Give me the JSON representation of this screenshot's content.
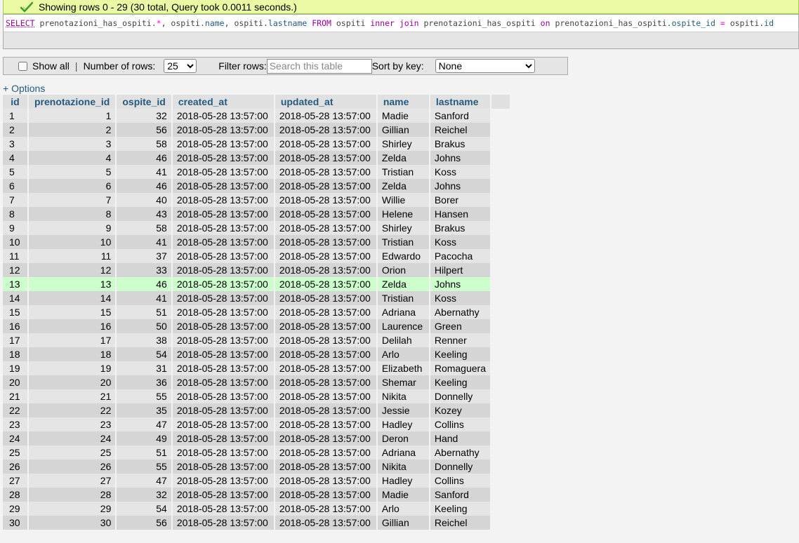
{
  "status": {
    "message": "Showing rows 0 - 29 (30 total, Query took 0.0011 seconds.)",
    "icon": "check-icon",
    "color": "#3c9d2e"
  },
  "sql": {
    "select_kw": "SELECT",
    "part1": " prenotazioni_has_ospiti.",
    "star": "*",
    "part2": ", ospiti.",
    "col_name": "name",
    "part3": ", ospiti.",
    "col_lastname": "lastname",
    "from_kw": " FROM ",
    "table1": "ospiti ",
    "join_kw": "inner join",
    "table2": " prenotazioni_has_ospiti ",
    "on_kw": "on",
    "part4": " prenotazioni_has_ospiti.",
    "col_ospite_id": "ospite_id",
    "eq": " = ",
    "part5": "ospiti.",
    "col_id": "id"
  },
  "navbar": {
    "show_all_label": "Show all",
    "separator": "|",
    "rows_label": "Number of rows:",
    "rows_value": "25",
    "filter_label": "Filter rows:",
    "filter_placeholder": "Search this table",
    "sort_label": "Sort by key:",
    "sort_value": "None"
  },
  "options_link": "+ Options",
  "table": {
    "columns": [
      "id",
      "prenotazione_id",
      "ospite_id",
      "created_at",
      "updated_at",
      "name",
      "lastname"
    ],
    "highlight_row": 13,
    "rows": [
      [
        "1",
        "1",
        "32",
        "2018-05-28 13:57:00",
        "2018-05-28 13:57:00",
        "Madie",
        "Sanford"
      ],
      [
        "2",
        "2",
        "56",
        "2018-05-28 13:57:00",
        "2018-05-28 13:57:00",
        "Gillian",
        "Reichel"
      ],
      [
        "3",
        "3",
        "58",
        "2018-05-28 13:57:00",
        "2018-05-28 13:57:00",
        "Shirley",
        "Brakus"
      ],
      [
        "4",
        "4",
        "46",
        "2018-05-28 13:57:00",
        "2018-05-28 13:57:00",
        "Zelda",
        "Johns"
      ],
      [
        "5",
        "5",
        "41",
        "2018-05-28 13:57:00",
        "2018-05-28 13:57:00",
        "Tristian",
        "Koss"
      ],
      [
        "6",
        "6",
        "46",
        "2018-05-28 13:57:00",
        "2018-05-28 13:57:00",
        "Zelda",
        "Johns"
      ],
      [
        "7",
        "7",
        "40",
        "2018-05-28 13:57:00",
        "2018-05-28 13:57:00",
        "Willie",
        "Borer"
      ],
      [
        "8",
        "8",
        "43",
        "2018-05-28 13:57:00",
        "2018-05-28 13:57:00",
        "Helene",
        "Hansen"
      ],
      [
        "9",
        "9",
        "58",
        "2018-05-28 13:57:00",
        "2018-05-28 13:57:00",
        "Shirley",
        "Brakus"
      ],
      [
        "10",
        "10",
        "41",
        "2018-05-28 13:57:00",
        "2018-05-28 13:57:00",
        "Tristian",
        "Koss"
      ],
      [
        "11",
        "11",
        "37",
        "2018-05-28 13:57:00",
        "2018-05-28 13:57:00",
        "Edwardo",
        "Pacocha"
      ],
      [
        "12",
        "12",
        "33",
        "2018-05-28 13:57:00",
        "2018-05-28 13:57:00",
        "Orion",
        "Hilpert"
      ],
      [
        "13",
        "13",
        "46",
        "2018-05-28 13:57:00",
        "2018-05-28 13:57:00",
        "Zelda",
        "Johns"
      ],
      [
        "14",
        "14",
        "41",
        "2018-05-28 13:57:00",
        "2018-05-28 13:57:00",
        "Tristian",
        "Koss"
      ],
      [
        "15",
        "15",
        "51",
        "2018-05-28 13:57:00",
        "2018-05-28 13:57:00",
        "Adriana",
        "Abernathy"
      ],
      [
        "16",
        "16",
        "50",
        "2018-05-28 13:57:00",
        "2018-05-28 13:57:00",
        "Laurence",
        "Green"
      ],
      [
        "17",
        "17",
        "38",
        "2018-05-28 13:57:00",
        "2018-05-28 13:57:00",
        "Delilah",
        "Renner"
      ],
      [
        "18",
        "18",
        "54",
        "2018-05-28 13:57:00",
        "2018-05-28 13:57:00",
        "Arlo",
        "Keeling"
      ],
      [
        "19",
        "19",
        "31",
        "2018-05-28 13:57:00",
        "2018-05-28 13:57:00",
        "Elizabeth",
        "Romaguera"
      ],
      [
        "20",
        "20",
        "36",
        "2018-05-28 13:57:00",
        "2018-05-28 13:57:00",
        "Shemar",
        "Keeling"
      ],
      [
        "21",
        "21",
        "55",
        "2018-05-28 13:57:00",
        "2018-05-28 13:57:00",
        "Nikita",
        "Donnelly"
      ],
      [
        "22",
        "22",
        "35",
        "2018-05-28 13:57:00",
        "2018-05-28 13:57:00",
        "Jessie",
        "Kozey"
      ],
      [
        "23",
        "23",
        "47",
        "2018-05-28 13:57:00",
        "2018-05-28 13:57:00",
        "Hadley",
        "Collins"
      ],
      [
        "24",
        "24",
        "49",
        "2018-05-28 13:57:00",
        "2018-05-28 13:57:00",
        "Deron",
        "Hand"
      ],
      [
        "25",
        "25",
        "51",
        "2018-05-28 13:57:00",
        "2018-05-28 13:57:00",
        "Adriana",
        "Abernathy"
      ],
      [
        "26",
        "26",
        "55",
        "2018-05-28 13:57:00",
        "2018-05-28 13:57:00",
        "Nikita",
        "Donnelly"
      ],
      [
        "27",
        "27",
        "47",
        "2018-05-28 13:57:00",
        "2018-05-28 13:57:00",
        "Hadley",
        "Collins"
      ],
      [
        "28",
        "28",
        "32",
        "2018-05-28 13:57:00",
        "2018-05-28 13:57:00",
        "Madie",
        "Sanford"
      ],
      [
        "29",
        "29",
        "54",
        "2018-05-28 13:57:00",
        "2018-05-28 13:57:00",
        "Arlo",
        "Keeling"
      ],
      [
        "30",
        "30",
        "56",
        "2018-05-28 13:57:00",
        "2018-05-28 13:57:00",
        "Gillian",
        "Reichel"
      ]
    ]
  }
}
